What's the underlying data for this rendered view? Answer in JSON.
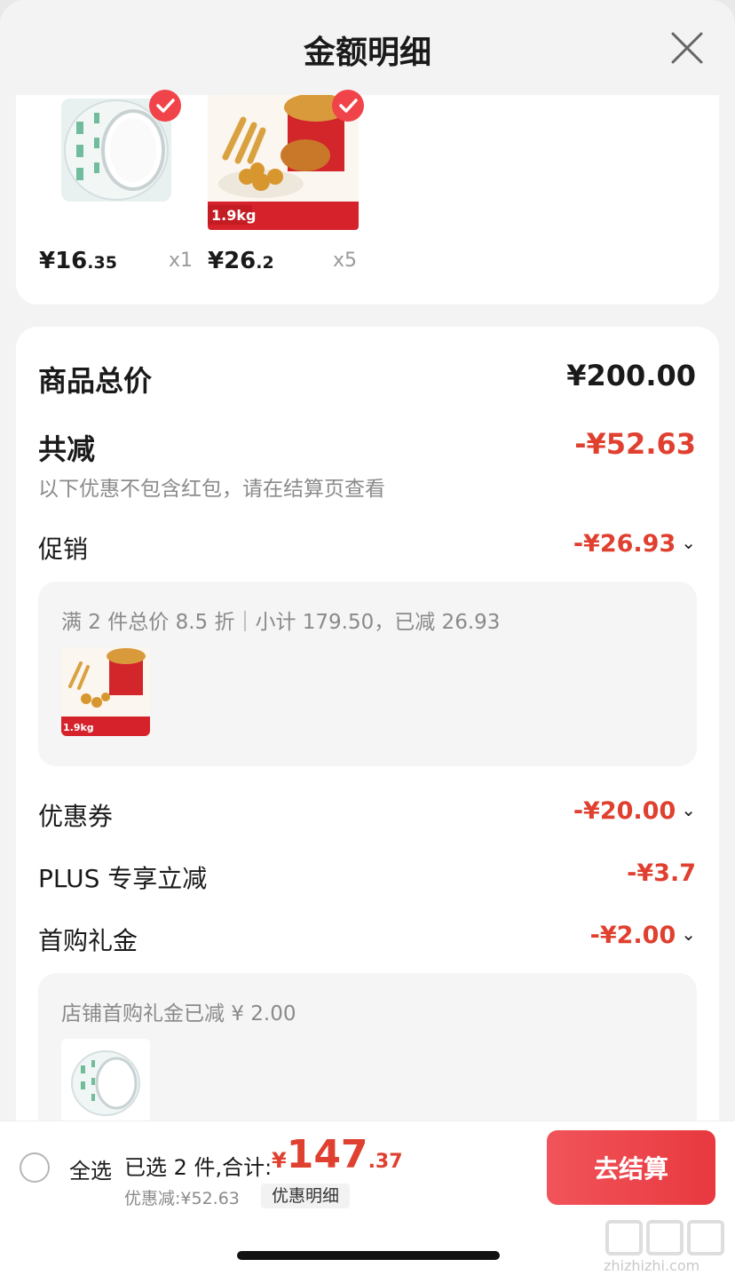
{
  "header": {
    "title": "金额明细"
  },
  "products": [
    {
      "price_int": "¥16",
      "price_dec": ".35",
      "qty": "x1"
    },
    {
      "price_int": "¥26",
      "price_dec": ".2",
      "qty": "x5",
      "badge": "1.9kg"
    }
  ],
  "summary": {
    "total_label": "商品总价",
    "total_value": "¥200.00",
    "reduced_label": "共减",
    "reduced_value": "-¥52.63",
    "reduced_note": "以下优惠不包含红包，请在结算页查看"
  },
  "promotion": {
    "label": "促销",
    "value": "-¥26.93",
    "detail": "满 2 件总价 8.5 折｜小计 179.50，已减 26.93",
    "item_badge": "1.9kg"
  },
  "coupon": {
    "label": "优惠券",
    "value": "-¥20.00"
  },
  "plus": {
    "label": "PLUS 专享立减",
    "value": "-¥3.7"
  },
  "first_gift": {
    "label": "首购礼金",
    "value": "-¥2.00",
    "detail": "店铺首购礼金已减 ¥ 2.00"
  },
  "bottom": {
    "select_all": "全选",
    "selected_text": "已选 2 件,合计:",
    "currency": "¥",
    "total_int": "147",
    "total_dec": ".37",
    "discount_text": "优惠减:¥52.63",
    "detail_chip": "优惠明细",
    "checkout": "去结算"
  },
  "watermark": "zhizhizhi.com",
  "colors": {
    "accent_red": "#e0402f",
    "button_red": "#ec4448",
    "check_red": "#f0434a"
  },
  "icons": [
    "close-icon",
    "check-icon",
    "chevron-down-icon",
    "radio-unchecked-icon"
  ]
}
